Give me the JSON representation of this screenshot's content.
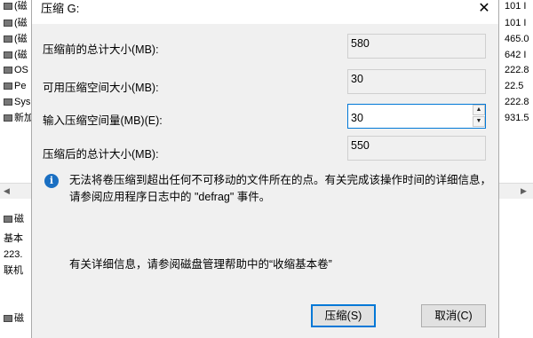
{
  "background": {
    "left_rows": [
      "(磁",
      "(磁",
      "(磁",
      "(磁",
      "OS",
      "Pe",
      "Sys",
      "新加"
    ],
    "right_rows": [
      "101 I",
      "101 I",
      "465.0",
      "642 I",
      "222.8",
      "22.5",
      "222.8",
      "931.5"
    ],
    "lower_left": [
      "磁",
      "基本",
      "223.",
      "联机"
    ]
  },
  "dialog": {
    "title": "压缩 G:",
    "close_glyph": "✕",
    "fields": {
      "total_before_label": "压缩前的总计大小(MB):",
      "total_before_value": "580",
      "available_label": "可用压缩空间大小(MB):",
      "available_value": "30",
      "input_label": "输入压缩空间量(MB)(E):",
      "input_value": "30",
      "total_after_label": "压缩后的总计大小(MB):",
      "total_after_value": "550"
    },
    "info_message": "无法将卷压缩到超出任何不可移动的文件所在的点。有关完成该操作时间的详细信息，请参阅应用程序日志中的 \"defrag\" 事件。",
    "help_message": "有关详细信息，请参阅磁盘管理帮助中的“收缩基本卷”",
    "buttons": {
      "shrink": "压缩(S)",
      "cancel": "取消(C)"
    }
  }
}
